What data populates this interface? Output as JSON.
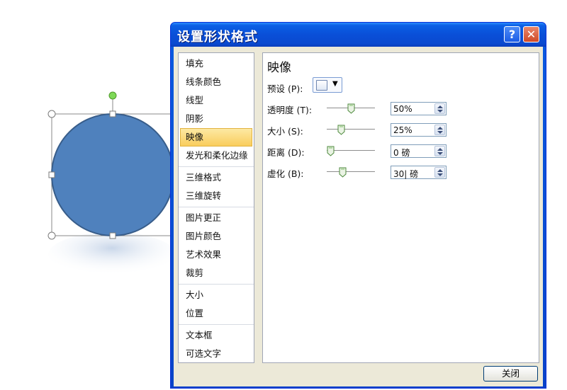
{
  "dialog": {
    "title": "设置形状格式",
    "help_glyph": "?",
    "close_glyph": "✕",
    "close_button_label": "关闭"
  },
  "nav": {
    "groups": [
      [
        "填充",
        "线条颜色",
        "线型",
        "阴影",
        "映像",
        "发光和柔化边缘"
      ],
      [
        "三维格式",
        "三维旋转"
      ],
      [
        "图片更正",
        "图片颜色",
        "艺术效果",
        "裁剪"
      ],
      [
        "大小",
        "位置"
      ],
      [
        "文本框",
        "可选文字"
      ]
    ],
    "active": "映像"
  },
  "panel": {
    "title": "映像",
    "preset_label": "预设 (P):",
    "rows": [
      {
        "label": "透明度 (T):",
        "value": "50%",
        "level": 0.5
      },
      {
        "label": "大小 (S):",
        "value": "25%",
        "level": 0.25
      },
      {
        "label": "距离 (D):",
        "value": "0 磅",
        "level": 0.0
      },
      {
        "label": "虚化 (B):",
        "value": "30| 磅",
        "level": 0.3
      }
    ]
  },
  "shape": {
    "fill_color": "#4f81bd",
    "outline_color": "#385d8a",
    "rotation_handle_color": "#7ed957"
  },
  "colors": {
    "accent_selected": "#f9cd5d",
    "titlebar": "#0a4fd8"
  }
}
